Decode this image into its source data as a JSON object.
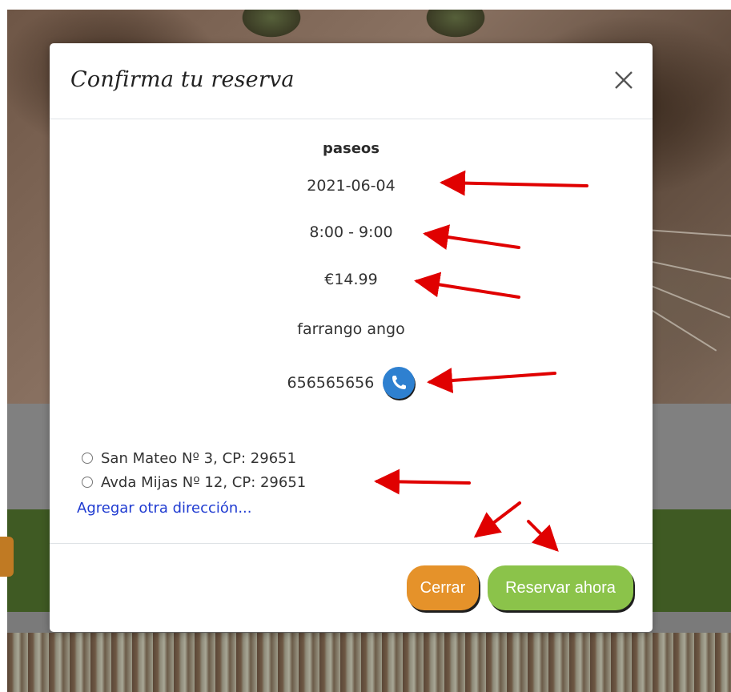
{
  "modal": {
    "title": "Confirma tu reserva",
    "close_icon": "close-icon",
    "service": "paseos",
    "date": "2021-06-04",
    "time": "8:00 - 9:00",
    "price": "€14.99",
    "name": "farrango ango",
    "phone": "656565656",
    "phone_icon": "phone-icon",
    "addresses": [
      {
        "label": "San Mateo Nº 3, CP: 29651",
        "selected": false
      },
      {
        "label": "Avda Mijas Nº 12, CP: 29651",
        "selected": false
      }
    ],
    "add_address_link": "Agregar otra dirección...",
    "footer": {
      "close_label": "Cerrar",
      "reserve_label": "Reservar ahora"
    }
  },
  "colors": {
    "close_button": "#e5922a",
    "reserve_button": "#8bc34a",
    "phone_button": "#2e80d0",
    "link": "#1f3bd1",
    "annotation_arrows": "#e00000"
  }
}
